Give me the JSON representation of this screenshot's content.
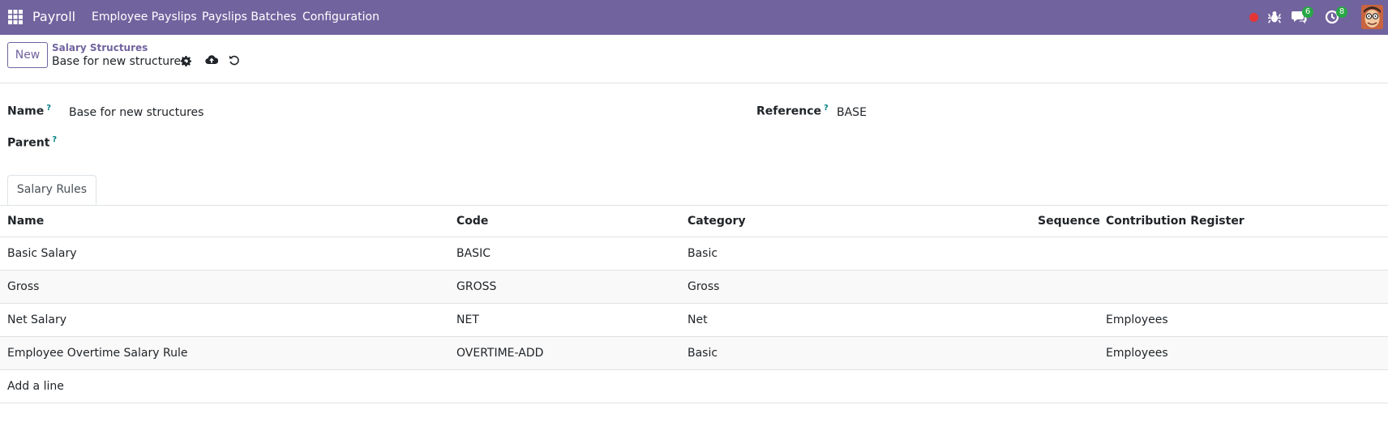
{
  "navbar": {
    "brand": "Payroll",
    "menu": [
      "Employee Payslips",
      "Payslips Batches",
      "Configuration"
    ],
    "chat_badge": "6",
    "activity_badge": "8",
    "colors": {
      "bar": "#71639e",
      "badge": "#28a745",
      "record": "#e63535"
    }
  },
  "control_panel": {
    "new_label": "New",
    "breadcrumb_parent": "Salary Structures",
    "breadcrumb_current": "Base for new structures"
  },
  "form": {
    "name_label": "Name",
    "name_value": "Base for new structures",
    "parent_label": "Parent",
    "reference_label": "Reference",
    "reference_value": "BASE",
    "help_mark": "?"
  },
  "tabs": [
    "Salary Rules"
  ],
  "table": {
    "columns": [
      "Name",
      "Code",
      "Category",
      "Sequence",
      "Contribution Register"
    ],
    "rows": [
      [
        "Basic Salary",
        "BASIC",
        "Basic",
        "",
        ""
      ],
      [
        "Gross",
        "GROSS",
        "Gross",
        "",
        ""
      ],
      [
        "Net Salary",
        "NET",
        "Net",
        "",
        "Employees"
      ],
      [
        "Employee Overtime Salary Rule",
        "OVERTIME-ADD",
        "Basic",
        "",
        "Employees"
      ]
    ],
    "add_line": "Add a line"
  }
}
